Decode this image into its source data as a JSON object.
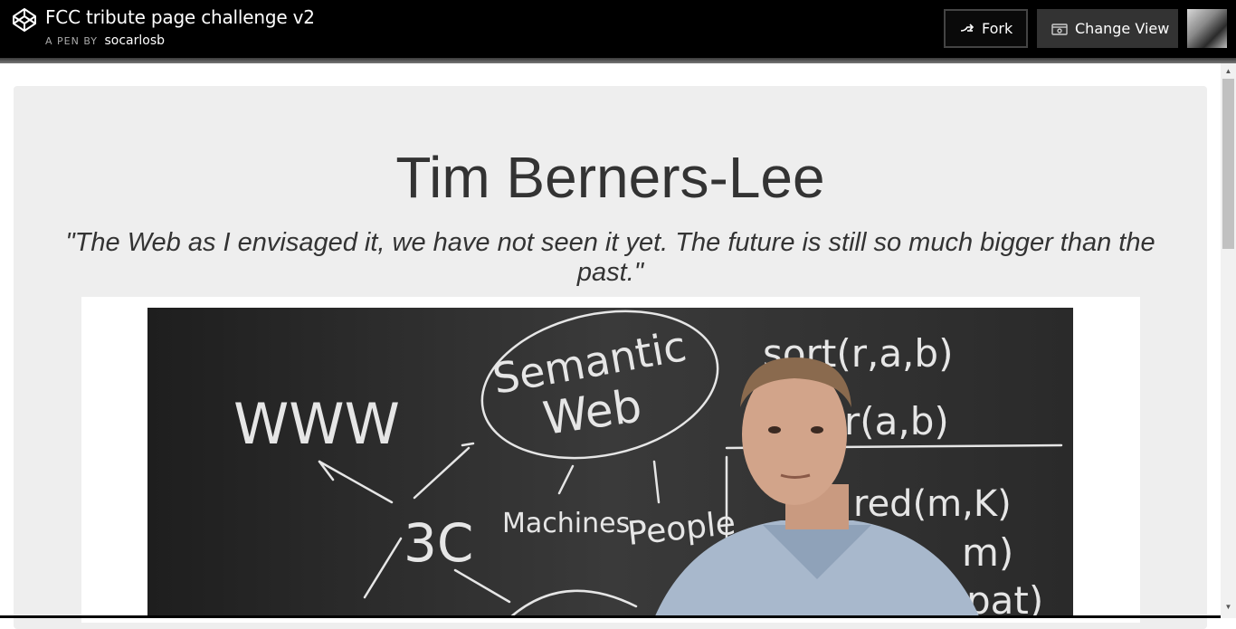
{
  "header": {
    "title": "FCC tribute page challenge v2",
    "byline_prefix": "A PEN BY",
    "author": "socarlosb",
    "fork_label": "Fork",
    "change_view_label": "Change View"
  },
  "page": {
    "headline": "Tim Berners-Lee",
    "quote": "\"The Web as I envisaged it, we have not seen it yet. The future is still so much bigger than the past.\""
  },
  "chalkboard": {
    "www": "WWW",
    "semantic": "Semantic",
    "web": "Web",
    "w3c": "3C",
    "machines": "Machines",
    "people": "People",
    "sort": "sort(r,a,b)",
    "r": "r(a,b)",
    "red": "red(m,K)",
    "m": "m)",
    "pat": "pat)"
  },
  "colors": {
    "topbar": "#000000",
    "card": "#eeeeee",
    "text": "#333333",
    "chalkboard": "#2c2c2c"
  },
  "icons": {
    "logo": "codepen-logo-icon",
    "fork": "fork-icon",
    "view": "change-view-icon",
    "scroll_up": "arrow-up-icon",
    "scroll_down": "arrow-down-icon"
  }
}
